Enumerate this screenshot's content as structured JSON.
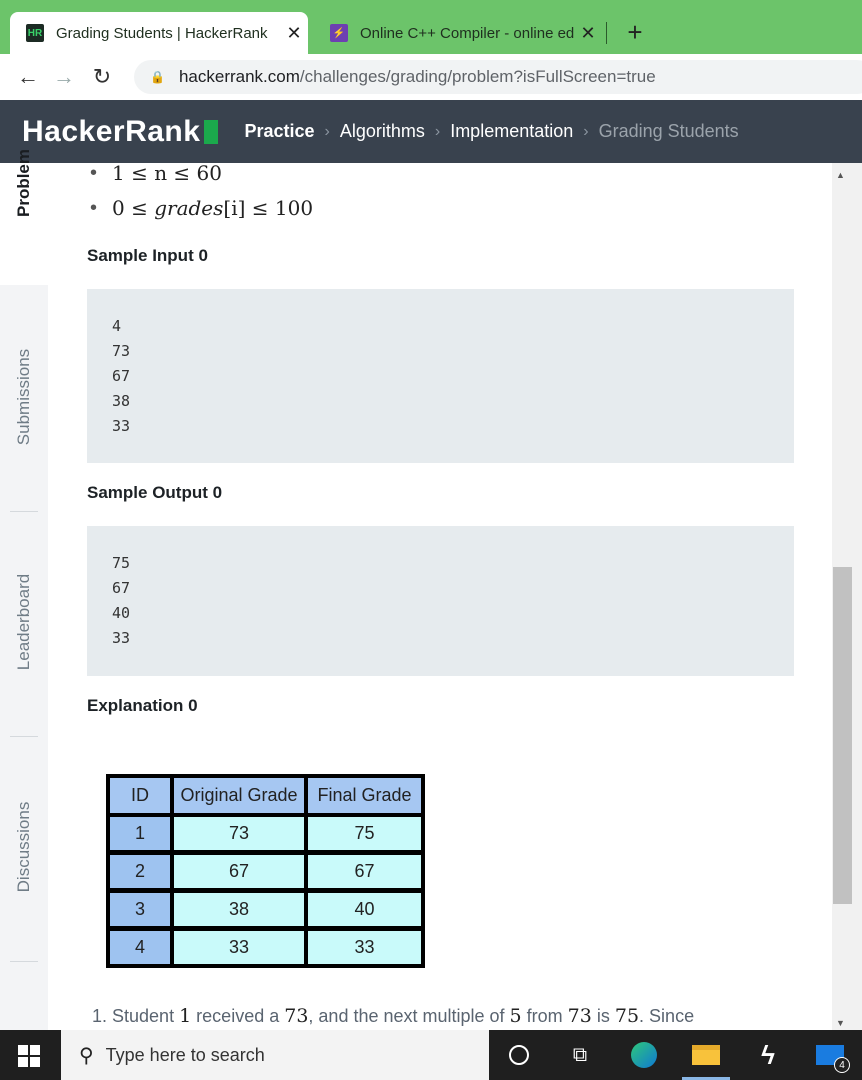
{
  "browser": {
    "tabs": [
      {
        "title": "Grading Students | HackerRank",
        "favicon": "HR",
        "close": "✕"
      },
      {
        "title": "Online C++ Compiler - online ed",
        "favicon": "⚡",
        "close": "✕"
      }
    ],
    "new_tab": "+",
    "url_domain": "hackerrank.com",
    "url_path": "/challenges/grading/problem?isFullScreen=true"
  },
  "header": {
    "logo": "HackerRank",
    "breadcrumbs": [
      "Practice",
      "Algorithms",
      "Implementation",
      "Grading Students"
    ]
  },
  "side_tabs": [
    "Problem",
    "Submissions",
    "Leaderboard",
    "Discussions"
  ],
  "constraints": {
    "c1": "1 ≤ n ≤ 60",
    "c2_pre": "0 ≤ ",
    "c2_var": "grades",
    "c2_idx": "[i]",
    "c2_post": " ≤ 100"
  },
  "sample_input": {
    "heading": "Sample Input 0",
    "lines": [
      "4",
      "73",
      "67",
      "38",
      "33"
    ]
  },
  "sample_output": {
    "heading": "Sample Output 0",
    "lines": [
      "75",
      "67",
      "40",
      "33"
    ]
  },
  "explanation": {
    "heading": "Explanation 0",
    "table": {
      "headers": [
        "ID",
        "Original Grade",
        "Final Grade"
      ],
      "rows": [
        [
          "1",
          "73",
          "75"
        ],
        [
          "2",
          "67",
          "67"
        ],
        [
          "3",
          "38",
          "40"
        ],
        [
          "4",
          "33",
          "33"
        ]
      ]
    },
    "paragraph": {
      "prefix": "1. Student ",
      "v1": "1",
      "t2": " received a ",
      "v2": "73",
      "t3": ", and the next multiple of ",
      "v3": "5",
      "t4": " from ",
      "v4": "73",
      "t5": " is ",
      "v5": "75",
      "t6": ". Since"
    }
  },
  "taskbar": {
    "search_placeholder": "Type here to search",
    "mail_badge": "4"
  }
}
